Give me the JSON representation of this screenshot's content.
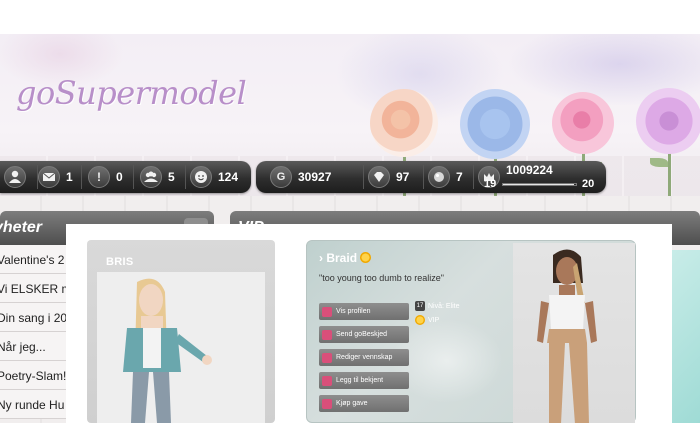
{
  "header": {
    "logo": "goSupermodel"
  },
  "statbar": {
    "user_icon": "user-icon",
    "messages": "1",
    "alerts": "0",
    "friends": "5",
    "smileys": "124",
    "coins": "30927",
    "diamonds": "97",
    "pearls": "7",
    "crown_icon": "crown-icon",
    "xp": {
      "current": "1009224",
      "level_from": "19",
      "level_to": "20",
      "progress": 0.97
    }
  },
  "news": {
    "heading": "yheter",
    "toggle": "",
    "items": [
      "Valentine's 2",
      "Vi ELSKER m",
      "Din sang i 20",
      "Når jeg...",
      "Poetry-Slam!",
      "Ny runde Hu"
    ]
  },
  "vip": {
    "heading": "VIP"
  },
  "profile_card": {
    "name": "BRIS"
  },
  "vip_card": {
    "name": "Braid",
    "quote": "\"too young too dumb to realize\"",
    "actions": [
      "Vis profilen",
      "Send goBeskjed",
      "Rediger vennskap",
      "Legg til bekjent",
      "Kjøp gave"
    ],
    "level_badge": "17",
    "level_text": "Nivå: Elite",
    "vip_text": "VIP"
  }
}
